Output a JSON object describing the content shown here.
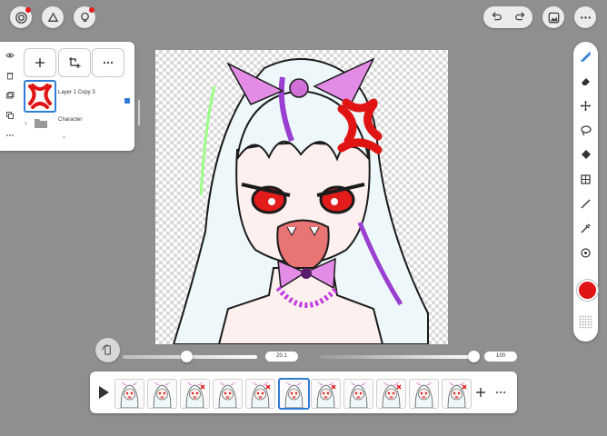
{
  "top_left": {
    "buttons": [
      {
        "name": "gallery-button",
        "icon": "swirl-icon"
      },
      {
        "name": "actions-button",
        "icon": "wrench-icon"
      },
      {
        "name": "ideas-button",
        "icon": "lightbulb-icon"
      }
    ],
    "notification_color": "#e31d1d"
  },
  "top_right": {
    "undo_icon": "undo-icon",
    "redo_icon": "redo-icon",
    "reference_icon": "image-icon",
    "more_icon": "more-icon"
  },
  "layer_panel": {
    "actions": [
      {
        "name": "add-layer-button",
        "icon": "plus-icon"
      },
      {
        "name": "add-group-button",
        "icon": "crop-plus-icon"
      },
      {
        "name": "layer-more-button",
        "icon": "more-icon"
      }
    ],
    "side_icons": [
      "eye-icon",
      "trash-icon",
      "layers-icon",
      "duplicate-icon",
      "more-icon"
    ],
    "layers": [
      {
        "name": "Layer 1 Copy 3",
        "selected": true
      },
      {
        "name": "Character",
        "type": "folder"
      }
    ]
  },
  "toolbar": {
    "tools": [
      "brush-icon",
      "eraser-icon",
      "move-icon",
      "lasso-icon",
      "fill-icon",
      "transform-icon",
      "line-icon",
      "eyedropper-icon",
      "stamp-icon"
    ],
    "current_color": "#e11414"
  },
  "sliders": {
    "brush_size": "20.1",
    "opacity": "100",
    "brush_size_fraction": 0.35,
    "opacity_fraction": 1.0
  },
  "timeline": {
    "frame_count": 11,
    "selected_frame": 5,
    "play_icon": "play-icon",
    "add_icon": "plus-icon",
    "more_icon": "more-icon"
  },
  "colors": {
    "accent": "#2f7cd6",
    "background": "#8f8f8f",
    "anger_mark": "#e11414",
    "bow": "#e38ce6",
    "hair_streak": "#9b3fd1"
  }
}
